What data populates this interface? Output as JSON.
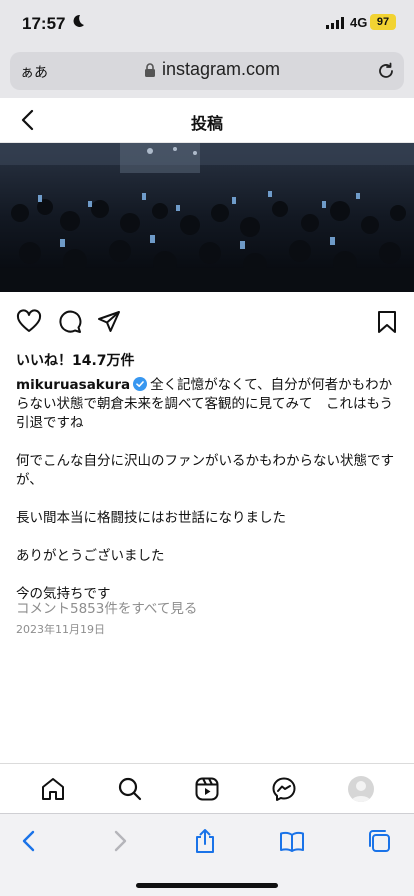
{
  "status_bar": {
    "time": "17:57",
    "network": "4G",
    "battery": "97",
    "icons": [
      "moon-icon",
      "signal-icon",
      "battery-icon"
    ]
  },
  "browser": {
    "text_size_label": "ぁあ",
    "url": "instagram.com",
    "icons": [
      "lock-icon",
      "reload-icon"
    ]
  },
  "post_header": {
    "title": "投稿",
    "icons": [
      "back-chevron-icon"
    ]
  },
  "post": {
    "likes": "いいね！14.7万件",
    "username": "mikuruasakura",
    "caption": {
      "line1": "全く記憶がなくて、自分が何者かもわからない状態で朝倉未来を調べて客観的に見てみて　これはもう引退ですね",
      "line2": "何でこんな自分に沢山のファンがいるかもわからない状態ですが、",
      "line3": "長い間本当に格闘技にはお世話になりました",
      "line4": "ありがとうございました",
      "line5": "今の気持ちです"
    },
    "comments_link": "コメント5853件をすべて見る",
    "date": "2023年11月19日",
    "action_icons": [
      "heart-icon",
      "comment-icon",
      "share-icon",
      "bookmark-icon"
    ]
  },
  "ig_nav": {
    "icons": [
      "home-icon",
      "search-icon",
      "reels-icon",
      "messenger-icon",
      "profile-avatar"
    ]
  },
  "safari_toolbar": {
    "icons": [
      "back-arrow-icon",
      "forward-arrow-icon",
      "share-sheet-icon",
      "bookmarks-icon",
      "tabs-icon"
    ]
  },
  "colors": {
    "chrome_bg": "#e7e7ea",
    "battery": "#f2d332",
    "verified": "#3897f0",
    "ios_blue": "#1a73e8",
    "muted_text": "#8e8e8e"
  }
}
